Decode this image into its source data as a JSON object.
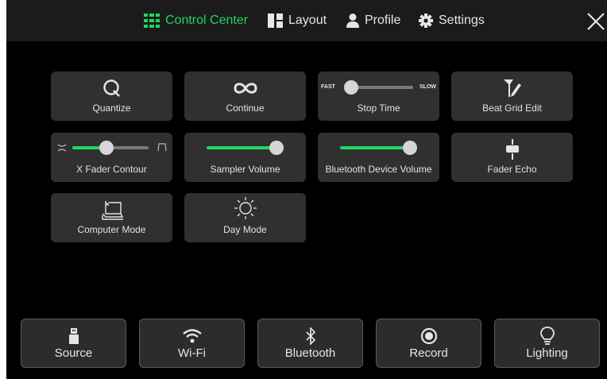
{
  "topbar": {
    "tabs": [
      {
        "label": "Control Center",
        "icon": "grid-icon",
        "active": true
      },
      {
        "label": "Layout",
        "icon": "layout-icon",
        "active": false
      },
      {
        "label": "Profile",
        "icon": "person-icon",
        "active": false
      },
      {
        "label": "Settings",
        "icon": "gear-icon",
        "active": false
      }
    ],
    "close_icon": "close-icon"
  },
  "controls": {
    "quantize": {
      "label": "Quantize",
      "icon": "quantize-icon"
    },
    "continue": {
      "label": "Continue",
      "icon": "infinity-icon"
    },
    "stop_time": {
      "label": "Stop Time",
      "min_label": "FAST",
      "max_label": "SLOW",
      "value": 0.08
    },
    "beat_grid_edit": {
      "label": "Beat Grid Edit",
      "icon": "grid-edit-pen-icon"
    },
    "x_fader_contour": {
      "label": "X Fader Contour",
      "value": 0.45,
      "left_icon": "sharp-curve-icon",
      "right_icon": "smooth-curve-icon"
    },
    "sampler_volume": {
      "label": "Sampler Volume",
      "value": 1.0
    },
    "bluetooth_device_volume": {
      "label": "Bluetooth Device Volume",
      "value": 1.0
    },
    "fader_echo": {
      "label": "Fader Echo",
      "icon": "fader-icon"
    },
    "computer_mode": {
      "label": "Computer Mode",
      "icon": "laptop-icon"
    },
    "day_mode": {
      "label": "Day Mode",
      "icon": "sun-icon"
    }
  },
  "bottom_bar": [
    {
      "label": "Source",
      "icon": "usb-drive-icon"
    },
    {
      "label": "Wi-Fi",
      "icon": "wifi-icon"
    },
    {
      "label": "Bluetooth",
      "icon": "bluetooth-icon"
    },
    {
      "label": "Record",
      "icon": "record-icon"
    },
    {
      "label": "Lighting",
      "icon": "lightbulb-icon"
    }
  ],
  "colors": {
    "accent": "#1ed760",
    "tile": "#303030",
    "background": "#000000",
    "topbar": "#1b1b1b"
  }
}
